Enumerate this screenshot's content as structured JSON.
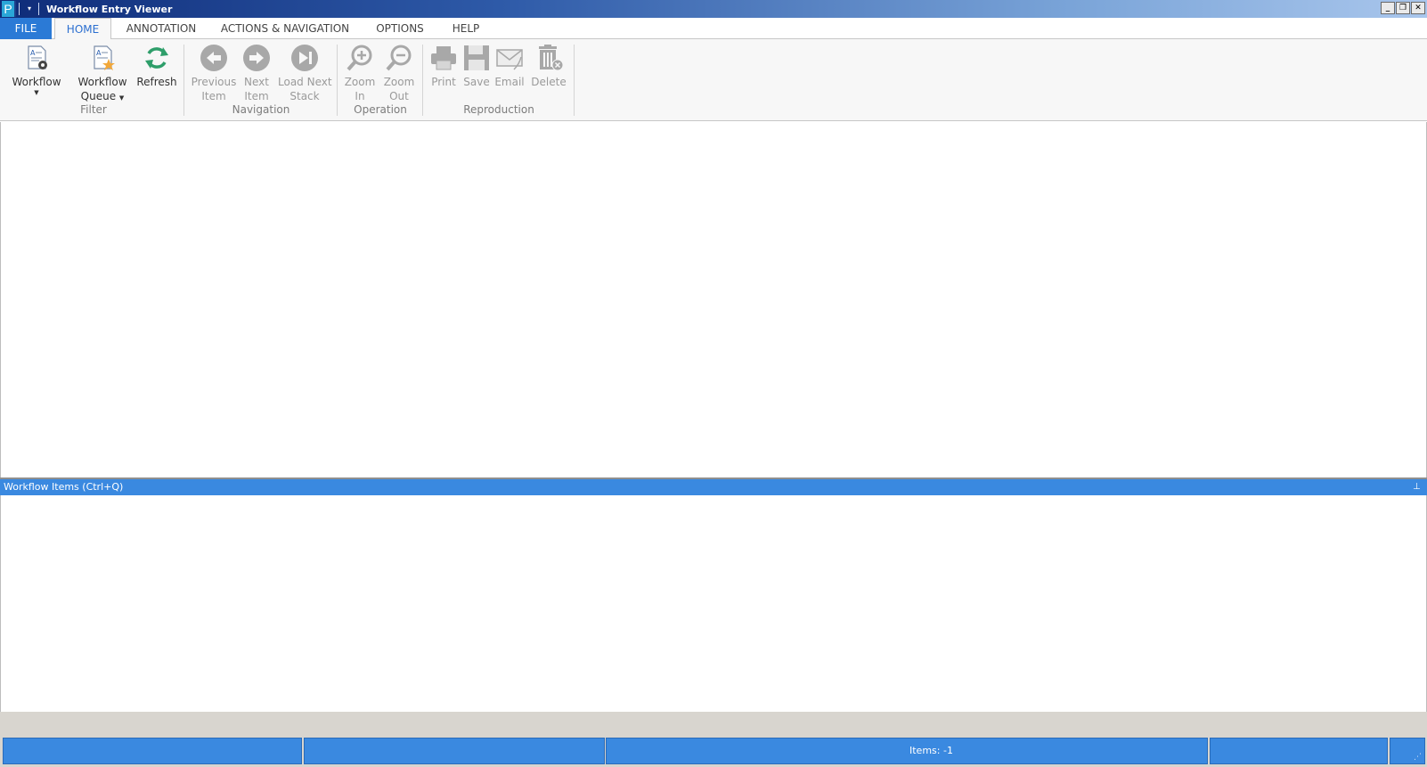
{
  "window": {
    "title": "Workflow Entry Viewer",
    "app_icon_letter": "P",
    "quick_access_dropdown": "▾",
    "controls": {
      "minimize": "_",
      "restore": "❐",
      "close": "✕"
    }
  },
  "tabs": [
    {
      "label": "FILE"
    },
    {
      "label": "HOME"
    },
    {
      "label": "ANNOTATION"
    },
    {
      "label": "ACTIONS & NAVIGATION"
    },
    {
      "label": "OPTIONS"
    },
    {
      "label": "HELP"
    }
  ],
  "ribbon": {
    "filter": {
      "label": "Filter",
      "workflow": {
        "label": "Workflow",
        "icon": "workflow-settings-icon"
      },
      "workflow_queue": {
        "line1": "Workflow",
        "line2": "Queue",
        "icon": "workflow-queue-star-icon"
      },
      "refresh": {
        "label": "Refresh",
        "icon": "refresh-icon"
      }
    },
    "navigation": {
      "label": "Navigation",
      "previous": {
        "line1": "Previous",
        "line2": "Item",
        "icon": "previous-arrow-icon"
      },
      "next": {
        "line1": "Next",
        "line2": "Item",
        "icon": "next-arrow-icon"
      },
      "load_next": {
        "line1": "Load Next",
        "line2": "Stack",
        "icon": "load-next-icon"
      }
    },
    "operation": {
      "label": "Operation",
      "zoom_in": {
        "line1": "Zoom",
        "line2": "In",
        "icon": "zoom-in-icon"
      },
      "zoom_out": {
        "line1": "Zoom",
        "line2": "Out",
        "icon": "zoom-out-icon"
      }
    },
    "reproduction": {
      "label": "Reproduction",
      "print": {
        "label": "Print",
        "icon": "printer-icon"
      },
      "save": {
        "label": "Save",
        "icon": "floppy-disk-icon"
      },
      "email": {
        "label": "Email",
        "icon": "envelope-icon"
      },
      "delete": {
        "label": "Delete",
        "icon": "trash-icon"
      }
    }
  },
  "workflow_items_pane": {
    "title": "Workflow Items (Ctrl+Q)",
    "pin": "⊥"
  },
  "statusbar": {
    "items_text": "Items: -1",
    "grip": "⋰"
  },
  "colors": {
    "accent": "#3a89e0",
    "file_tab": "#2b7ad6",
    "refresh_green": "#2e9e6a",
    "disabled_icon": "#a8a8a8"
  }
}
